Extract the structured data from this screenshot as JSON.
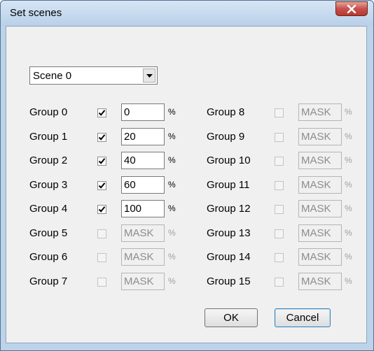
{
  "window": {
    "title": "Set scenes"
  },
  "scene_select": {
    "selected": "Scene 0"
  },
  "left_groups": [
    {
      "label": "Group 0",
      "checked": true,
      "value": "0",
      "unit": "%",
      "enabled": true
    },
    {
      "label": "Group 1",
      "checked": true,
      "value": "20",
      "unit": "%",
      "enabled": true
    },
    {
      "label": "Group 2",
      "checked": true,
      "value": "40",
      "unit": "%",
      "enabled": true
    },
    {
      "label": "Group 3",
      "checked": true,
      "value": "60",
      "unit": "%",
      "enabled": true
    },
    {
      "label": "Group 4",
      "checked": true,
      "value": "100",
      "unit": "%",
      "enabled": true
    },
    {
      "label": "Group 5",
      "checked": false,
      "value": "MASK",
      "unit": "%",
      "enabled": false
    },
    {
      "label": "Group 6",
      "checked": false,
      "value": "MASK",
      "unit": "%",
      "enabled": false
    },
    {
      "label": "Group 7",
      "checked": false,
      "value": "MASK",
      "unit": "%",
      "enabled": false
    }
  ],
  "right_groups": [
    {
      "label": "Group 8",
      "checked": false,
      "value": "MASK",
      "unit": "%",
      "enabled": false
    },
    {
      "label": "Group 9",
      "checked": false,
      "value": "MASK",
      "unit": "%",
      "enabled": false
    },
    {
      "label": "Group 10",
      "checked": false,
      "value": "MASK",
      "unit": "%",
      "enabled": false
    },
    {
      "label": "Group 11",
      "checked": false,
      "value": "MASK",
      "unit": "%",
      "enabled": false
    },
    {
      "label": "Group 12",
      "checked": false,
      "value": "MASK",
      "unit": "%",
      "enabled": false
    },
    {
      "label": "Group 13",
      "checked": false,
      "value": "MASK",
      "unit": "%",
      "enabled": false
    },
    {
      "label": "Group 14",
      "checked": false,
      "value": "MASK",
      "unit": "%",
      "enabled": false
    },
    {
      "label": "Group 15",
      "checked": false,
      "value": "MASK",
      "unit": "%",
      "enabled": false
    }
  ],
  "buttons": {
    "ok": "OK",
    "cancel": "Cancel"
  },
  "icons": {
    "close": "close-icon",
    "dropdown": "chevron-down-icon",
    "check": "checkmark-icon"
  }
}
